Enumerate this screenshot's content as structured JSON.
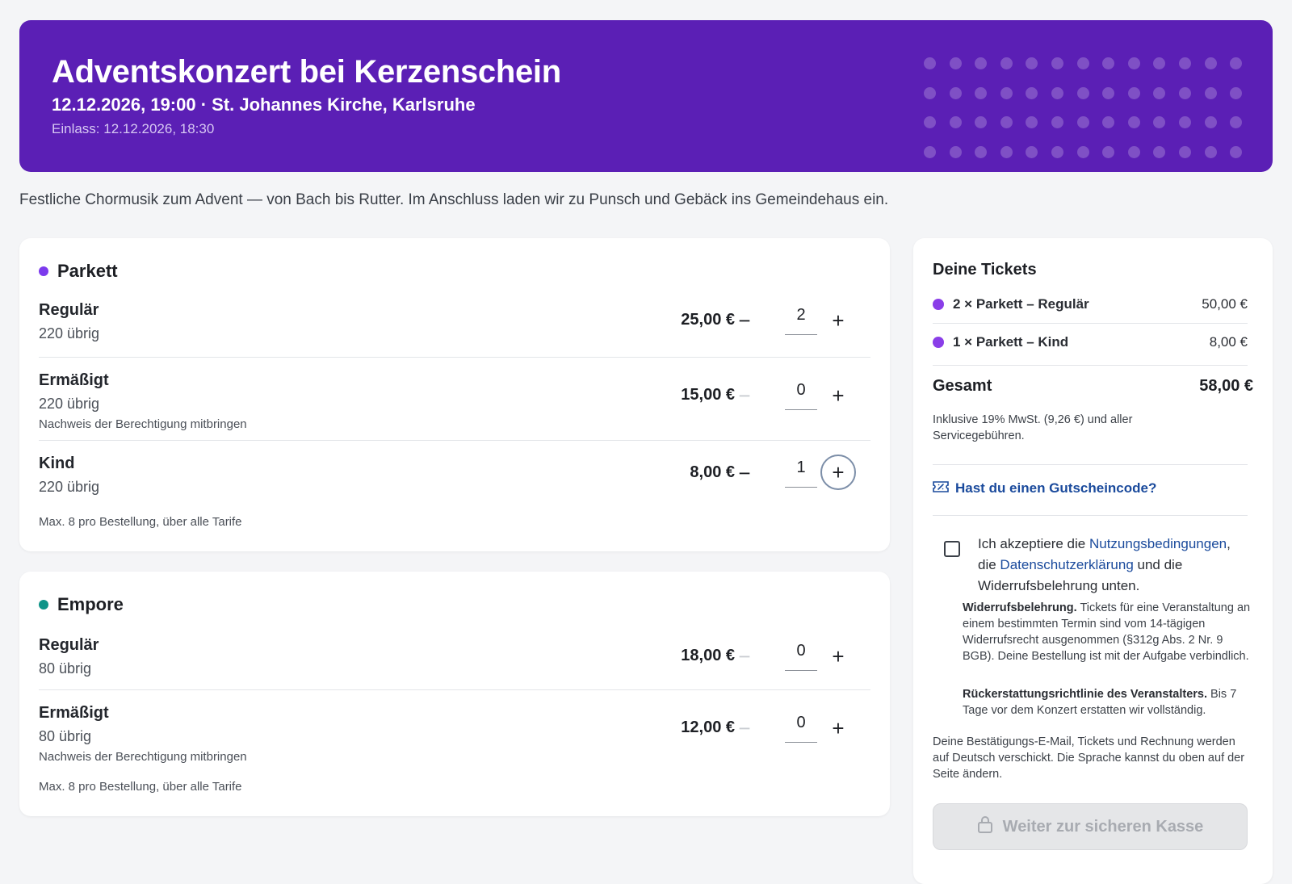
{
  "event": {
    "title": "Adventskonzert bei Kerzenschein",
    "subtitle": "12.12.2026, 19:00 · St. Johannes Kirche, Karlsruhe",
    "einlass": "Einlass: 12.12.2026, 18:30",
    "description": "Festliche Chormusik zum Advent — von Bach bis Rutter. Im Anschluss laden wir zu Punsch und Gebäck ins Gemeindehaus ein."
  },
  "sections": [
    {
      "name": "Parkett",
      "color": "#7c3aed",
      "rows": [
        {
          "name": "Regulär",
          "avail": "220 übrig",
          "note": "",
          "price": "25,00 €",
          "qty": "2"
        },
        {
          "name": "Ermäßigt",
          "avail": "220 übrig",
          "note": "Nachweis der Berechtigung mitbringen",
          "price": "15,00 €",
          "qty": "0"
        },
        {
          "name": "Kind",
          "avail": "220 übrig",
          "note": "",
          "price": "8,00 €",
          "qty": "1"
        }
      ],
      "max_note": "Max. 8 pro Bestellung, über alle Tarife"
    },
    {
      "name": "Empore",
      "color": "#0f9488",
      "rows": [
        {
          "name": "Regulär",
          "avail": "80 übrig",
          "note": "",
          "price": "18,00 €",
          "qty": "0"
        },
        {
          "name": "Ermäßigt",
          "avail": "80 übrig",
          "note": "Nachweis der Berechtigung mitbringen",
          "price": "12,00 €",
          "qty": "0"
        }
      ],
      "max_note": "Max. 8 pro Bestellung, über alle Tarife"
    }
  ],
  "controls": {
    "minus": "−",
    "plus": "+"
  },
  "sidebar": {
    "title": "Deine Tickets",
    "lines": [
      {
        "label": "2 × Parkett – Regulär",
        "price": "50,00 €"
      },
      {
        "label": "1 × Parkett – Kind",
        "price": "8,00 €"
      }
    ],
    "total_label": "Gesamt",
    "total_value": "58,00 €",
    "vat_note": "Inklusive 19% MwSt. (9,26 €) und aller Servicegebühren.",
    "voucher": "Hast du einen Gutscheincode?",
    "accept_1": "Ich akzeptiere die ",
    "accept_link_1": "Nutzungsbedingungen",
    "accept_2": ", die ",
    "accept_link_2": "Datenschutzerklärung",
    "accept_3": " und die Widerrufsbelehrung unten.",
    "widerruf_title": "Widerrufsbelehrung.",
    "widerruf_text": " Tickets für eine Veranstaltung an einem bestimmten Termin sind vom 14-tägigen Widerrufsrecht ausgenommen (§312g Abs. 2 Nr. 9 BGB). Deine Bestellung ist mit der Aufgabe verbindlich.",
    "refund_title": "Rückerstattungsrichtlinie des Veranstalters.",
    "refund_text": " Bis 7 Tage vor dem Konzert erstatten wir vollständig.",
    "lang_note": "Deine Bestätigungs-E-Mail, Tickets und Rechnung werden auf Deutsch verschickt. Die Sprache kannst du oben auf der Seite ändern.",
    "checkout": "Weiter zur sicheren Kasse"
  }
}
